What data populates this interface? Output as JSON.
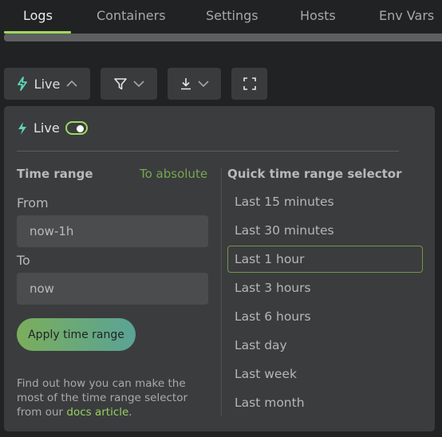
{
  "tabs": [
    {
      "label": "Logs",
      "active": true
    },
    {
      "label": "Containers",
      "active": false
    },
    {
      "label": "Settings",
      "active": false
    },
    {
      "label": "Hosts",
      "active": false
    },
    {
      "label": "Env Vars",
      "active": false
    }
  ],
  "toolbar": {
    "live_label": "Live",
    "live_icon": "lightning-icon",
    "filter_icon": "filter-icon",
    "download_icon": "download-icon",
    "fullscreen_icon": "fullscreen-icon"
  },
  "panel": {
    "live_label": "Live",
    "live_enabled": true,
    "time_range": {
      "title": "Time range",
      "to_absolute": "To absolute",
      "from_label": "From",
      "from_value": "now-1h",
      "to_label": "To",
      "to_value": "now",
      "apply_label": "Apply time range"
    },
    "help": {
      "text": "Find out how you can make the most of the time range selector from our ",
      "link": "docs article",
      "suffix": "."
    },
    "quick": {
      "title": "Quick time range selector",
      "items": [
        {
          "label": "Last 15 minutes"
        },
        {
          "label": "Last 30 minutes"
        },
        {
          "label": "Last 1 hour",
          "selected": true
        },
        {
          "label": "Last 3 hours"
        },
        {
          "label": "Last 6 hours"
        },
        {
          "label": "Last day"
        },
        {
          "label": "Last week"
        },
        {
          "label": "Last month"
        }
      ]
    }
  },
  "colors": {
    "accent": "#9fd85d",
    "live_icon": "#5ed3b8",
    "background": "#212224",
    "panel": "#3b3c3e"
  }
}
